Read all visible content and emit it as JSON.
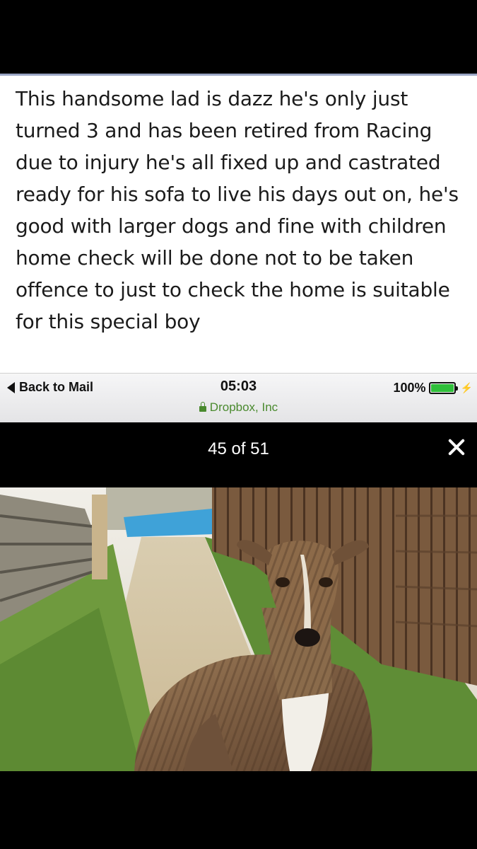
{
  "post": {
    "text": "This handsome lad is dazz he's only just turned 3 and has been retired from Racing due to injury he's all fixed up and castrated ready for his sofa to live his days out on, he's good with larger dogs and fine with children home check will be done not to be taken offence to just to check the home is suitable for this special boy"
  },
  "status_bar": {
    "back_label": "Back to Mail",
    "time": "05:03",
    "site": "Dropbox, Inc",
    "battery": "100%",
    "battery_level": 1.0
  },
  "viewer": {
    "counter": "45 of 51"
  },
  "icons": [
    "back-arrow-icon",
    "lock-icon",
    "battery-icon",
    "charging-bolt-icon",
    "close-icon"
  ],
  "colors": {
    "background": "#000000",
    "accent_rule": "#9aa5c4",
    "site_green": "#4a8a2e",
    "battery_green": "#2fbf3a"
  }
}
